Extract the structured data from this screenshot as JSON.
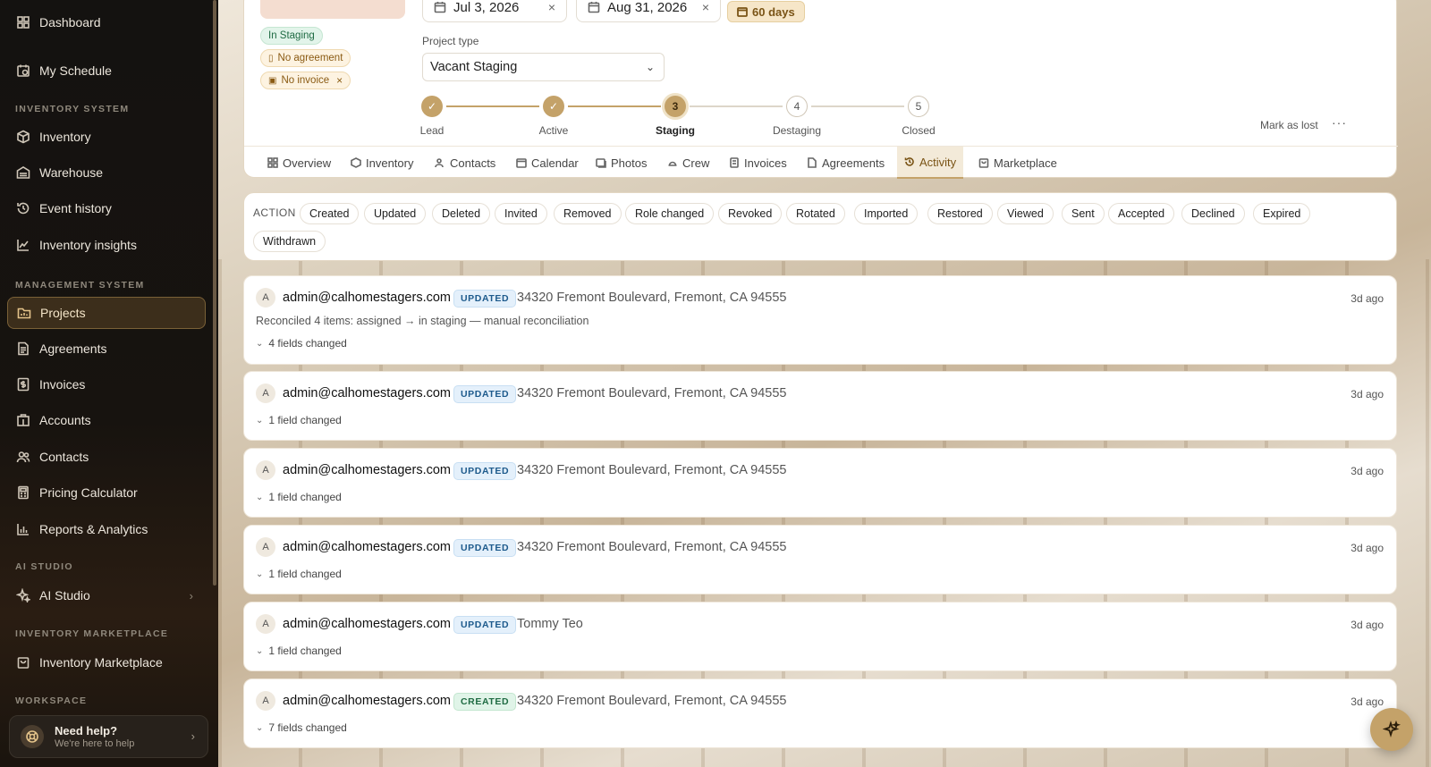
{
  "sidebar": {
    "items": [
      {
        "label": "Dashboard"
      },
      {
        "label": "My Schedule"
      },
      {
        "label": "Inventory"
      },
      {
        "label": "Warehouse"
      },
      {
        "label": "Event history"
      },
      {
        "label": "Inventory insights"
      },
      {
        "label": "Projects"
      },
      {
        "label": "Agreements"
      },
      {
        "label": "Invoices"
      },
      {
        "label": "Accounts"
      },
      {
        "label": "Contacts"
      },
      {
        "label": "Pricing Calculator"
      },
      {
        "label": "Reports & Analytics"
      },
      {
        "label": "AI Studio"
      },
      {
        "label": "Inventory Marketplace"
      }
    ],
    "sections": {
      "inventory_system": "INVENTORY SYSTEM",
      "management_system": "MANAGEMENT SYSTEM",
      "ai_studio": "AI STUDIO",
      "inventory_marketplace": "INVENTORY MARKETPLACE",
      "workspace": "WORKSPACE"
    },
    "help": {
      "title": "Need help?",
      "subtitle": "We're here to help"
    }
  },
  "project": {
    "status_badge": "In Staging",
    "agreement_badge": "No agreement",
    "invoice_badge": "No invoice",
    "start_date": "Jul 3, 2026",
    "end_date": "Aug 31, 2026",
    "duration": "60 days",
    "project_type_label": "Project type",
    "project_type_value": "Vacant Staging",
    "mark_lost": "Mark as lost",
    "more": "···"
  },
  "stages": [
    {
      "num": "1",
      "label": "Lead",
      "state": "done"
    },
    {
      "num": "2",
      "label": "Active",
      "state": "done"
    },
    {
      "num": "3",
      "label": "Staging",
      "state": "current"
    },
    {
      "num": "4",
      "label": "Destaging",
      "state": "todo"
    },
    {
      "num": "5",
      "label": "Closed",
      "state": "todo"
    }
  ],
  "tabs": [
    {
      "label": "Overview"
    },
    {
      "label": "Inventory"
    },
    {
      "label": "Contacts"
    },
    {
      "label": "Calendar"
    },
    {
      "label": "Photos"
    },
    {
      "label": "Crew"
    },
    {
      "label": "Invoices"
    },
    {
      "label": "Agreements"
    },
    {
      "label": "Activity"
    },
    {
      "label": "Marketplace"
    }
  ],
  "filters": {
    "title": "ACTION",
    "options": [
      "Created",
      "Updated",
      "Deleted",
      "Invited",
      "Removed",
      "Role changed",
      "Revoked",
      "Rotated",
      "Imported",
      "Restored",
      "Viewed",
      "Sent",
      "Accepted",
      "Declined",
      "Expired",
      "Withdrawn"
    ]
  },
  "activity": [
    {
      "avatar": "A",
      "user": "admin@calhomestagers.com",
      "tag": "UPDATED",
      "target": "34320 Fremont Boulevard, Fremont, CA 94555",
      "time": "3d ago",
      "summary": "Reconciled 4 items: assigned → in staging — manual reconciliation",
      "fields": "4 fields changed"
    },
    {
      "avatar": "A",
      "user": "admin@calhomestagers.com",
      "tag": "UPDATED",
      "target": "34320 Fremont Boulevard, Fremont, CA 94555",
      "time": "3d ago",
      "summary": "",
      "fields": "1 field changed"
    },
    {
      "avatar": "A",
      "user": "admin@calhomestagers.com",
      "tag": "UPDATED",
      "target": "34320 Fremont Boulevard, Fremont, CA 94555",
      "time": "3d ago",
      "summary": "",
      "fields": "1 field changed"
    },
    {
      "avatar": "A",
      "user": "admin@calhomestagers.com",
      "tag": "UPDATED",
      "target": "34320 Fremont Boulevard, Fremont, CA 94555",
      "time": "3d ago",
      "summary": "",
      "fields": "1 field changed"
    },
    {
      "avatar": "A",
      "user": "admin@calhomestagers.com",
      "tag": "UPDATED",
      "target": "Tommy Teo",
      "time": "3d ago",
      "summary": "",
      "fields": "1 field changed"
    },
    {
      "avatar": "A",
      "user": "admin@calhomestagers.com",
      "tag": "CREATED",
      "target": "34320 Fremont Boulevard, Fremont, CA 94555",
      "time": "3d ago",
      "summary": "",
      "fields": "7 fields changed"
    }
  ],
  "colors": {
    "accent": "#c4a269",
    "sidebar_bg": "#141210"
  }
}
